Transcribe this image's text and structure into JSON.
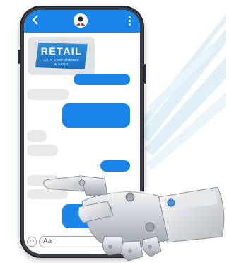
{
  "header": {
    "back_icon": "chevron-left-icon",
    "avatar_icon": "user-avatar-icon",
    "menu_icon": "more-vertical-icon",
    "color": "#1a86ea"
  },
  "logo": {
    "main": "RETAIL",
    "line1": "ASIA CONFERENCE",
    "line2": "& EXPO"
  },
  "chat": {
    "outgoing_color": "#1a86ea",
    "incoming_color": "#e9e9ec"
  },
  "composer": {
    "placeholder": "Aa",
    "emoji_icon": "emoji-icon",
    "send_icon": "send-icon"
  }
}
